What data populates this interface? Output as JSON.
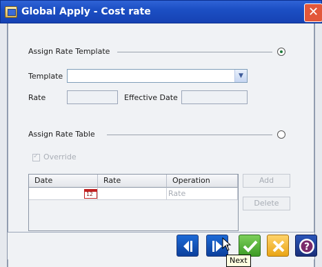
{
  "window": {
    "title": "Global Apply - Cost rate",
    "close_label": "✕"
  },
  "rate_template_section": {
    "heading": "Assign Rate Template",
    "selected": true,
    "template_label": "Template",
    "template_value": "",
    "rate_label": "Rate",
    "rate_value": "",
    "effective_date_label": "Effective Date",
    "effective_date_value": ""
  },
  "rate_table_section": {
    "heading": "Assign Rate Table",
    "selected": false,
    "override_label": "Override",
    "override_checked": true,
    "columns": [
      "Date",
      "Rate",
      "Operation"
    ],
    "rows": [
      {
        "date": "",
        "date_icon_text": "12",
        "rate": "",
        "operation": "Rate"
      }
    ],
    "add_label": "Add",
    "delete_label": "Delete"
  },
  "footer": {
    "tooltip": "Next"
  },
  "icons": {
    "window": "window-icon",
    "close": "close-icon",
    "dropdown": "chevron-down-icon",
    "calendar": "calendar-icon",
    "previous": "arrow-left-icon",
    "next": "arrow-right-icon",
    "ok": "check-icon",
    "cancel": "cancel-icon",
    "help": "help-icon"
  },
  "colors": {
    "titlebar": "#1c4fc4",
    "close": "#e2573a",
    "nav": "#0b3f9c",
    "ok": "#3c9a25",
    "cancel": "#e9a516",
    "help": "#1a2f7a"
  }
}
